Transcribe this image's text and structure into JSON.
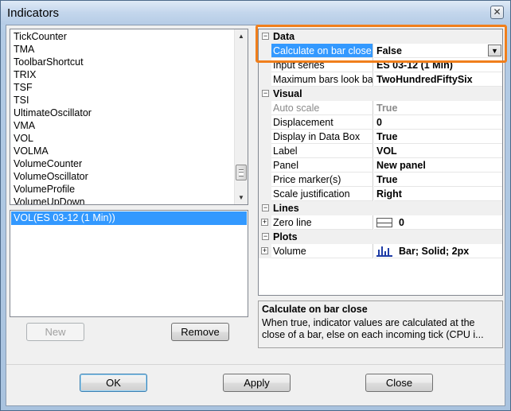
{
  "window": {
    "title": "Indicators",
    "close_glyph": "✕"
  },
  "indicator_list": {
    "items": [
      "TickCounter",
      "TMA",
      "ToolbarShortcut",
      "TRIX",
      "TSF",
      "TSI",
      "UltimateOscillator",
      "VMA",
      "VOL",
      "VOLMA",
      "VolumeCounter",
      "VolumeOscillator",
      "VolumeProfile",
      "VolumeUpDown"
    ]
  },
  "applied_list": {
    "selected_item": "VOL(ES 03-12 (1 Min))"
  },
  "buttons": {
    "new": "New",
    "remove": "Remove",
    "ok": "OK",
    "apply": "Apply",
    "close": "Close"
  },
  "property_grid": {
    "data": {
      "label": "Data",
      "calc_name": "Calculate on bar close",
      "calc_value": "False",
      "input_name": "Input series",
      "input_value": "ES 03-12 (1 Min)",
      "maxbars_name": "Maximum bars look back",
      "maxbars_value": "TwoHundredFiftySix"
    },
    "visual": {
      "label": "Visual",
      "autoscale_name": "Auto scale",
      "autoscale_value": "True",
      "displacement_name": "Displacement",
      "displacement_value": "0",
      "databox_name": "Display in Data Box",
      "databox_value": "True",
      "label_name": "Label",
      "label_value": "VOL",
      "panel_name": "Panel",
      "panel_value": "New panel",
      "pricemarker_name": "Price marker(s)",
      "pricemarker_value": "True",
      "scalejust_name": "Scale justification",
      "scalejust_value": "Right"
    },
    "lines": {
      "label": "Lines",
      "zero_name": "Zero line",
      "zero_value": "0"
    },
    "plots": {
      "label": "Plots",
      "volume_name": "Volume",
      "volume_value": "Bar; Solid; 2px"
    }
  },
  "description": {
    "title": "Calculate on bar close",
    "text": "When true, indicator values are calculated at the close of a bar, else on each incoming tick (CPU i..."
  },
  "colors": {
    "highlight": "#f07f1c",
    "selection": "#3399ff"
  }
}
